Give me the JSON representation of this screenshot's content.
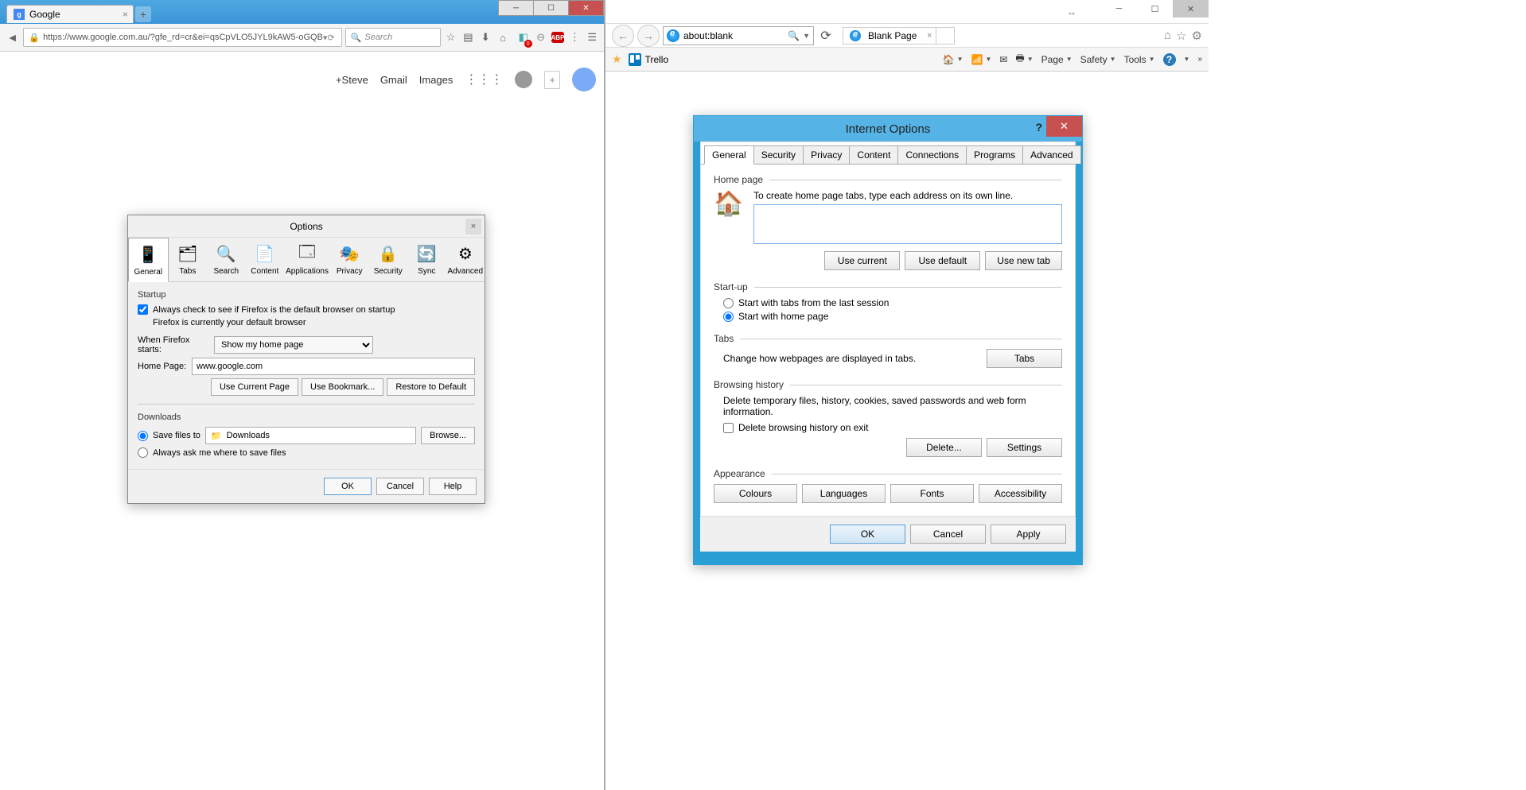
{
  "firefox": {
    "tab_title": "Google",
    "url": "https://www.google.com.au/?gfe_rd=cr&ei=qsCpVLO5JYL9kAW5-oGQB",
    "search_placeholder": "Search",
    "google_bar": {
      "user": "+Steve",
      "gmail": "Gmail",
      "images": "Images"
    },
    "dialog": {
      "title": "Options",
      "tabs": [
        "General",
        "Tabs",
        "Search",
        "Content",
        "Applications",
        "Privacy",
        "Security",
        "Sync",
        "Advanced"
      ],
      "startup_heading": "Startup",
      "always_check": "Always check to see if Firefox is the default browser on startup",
      "default_status": "Firefox is currently your default browser",
      "when_starts_label": "When Firefox starts:",
      "when_starts_value": "Show my home page",
      "home_page_label": "Home Page:",
      "home_page_value": "www.google.com",
      "use_current": "Use Current Page",
      "use_bookmark": "Use Bookmark...",
      "restore_default": "Restore to Default",
      "downloads_heading": "Downloads",
      "save_to_label": "Save files to",
      "downloads_folder": "Downloads",
      "browse": "Browse...",
      "always_ask": "Always ask me where to save files",
      "ok": "OK",
      "cancel": "Cancel",
      "help": "Help"
    }
  },
  "ie": {
    "url": "about:blank",
    "tab_title": "Blank Page",
    "favorite": "Trello",
    "menu": {
      "page": "Page",
      "safety": "Safety",
      "tools": "Tools"
    },
    "dialog": {
      "title": "Internet Options",
      "tabs": [
        "General",
        "Security",
        "Privacy",
        "Content",
        "Connections",
        "Programs",
        "Advanced"
      ],
      "home_heading": "Home page",
      "home_instruction": "To create home page tabs, type each address on its own line.",
      "use_current": "Use current",
      "use_default": "Use default",
      "use_new_tab": "Use new tab",
      "startup_heading": "Start-up",
      "start_last": "Start with tabs from the last session",
      "start_home": "Start with home page",
      "tabs_heading": "Tabs",
      "tabs_desc": "Change how webpages are displayed in tabs.",
      "tabs_btn": "Tabs",
      "history_heading": "Browsing history",
      "history_desc": "Delete temporary files, history, cookies, saved passwords and web form information.",
      "delete_on_exit": "Delete browsing history on exit",
      "delete": "Delete...",
      "settings": "Settings",
      "appearance_heading": "Appearance",
      "colours": "Colours",
      "languages": "Languages",
      "fonts": "Fonts",
      "accessibility": "Accessibility",
      "ok": "OK",
      "cancel": "Cancel",
      "apply": "Apply"
    }
  }
}
